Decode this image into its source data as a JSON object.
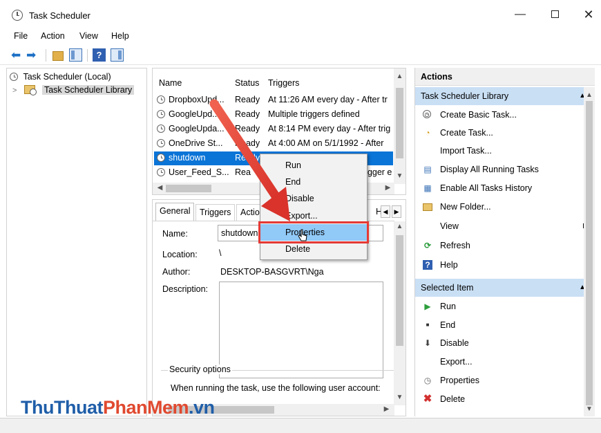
{
  "window": {
    "title": "Task Scheduler",
    "min": "—",
    "close": "✕"
  },
  "menu": [
    "File",
    "Action",
    "View",
    "Help"
  ],
  "toolbar": {
    "help_label": "?"
  },
  "tree": {
    "root": "Task Scheduler (Local)",
    "library": "Task Scheduler Library"
  },
  "tasklist": {
    "columns": [
      "Name",
      "Status",
      "Triggers"
    ],
    "rows": [
      {
        "name": "DropboxUpd...",
        "status": "Ready",
        "triggers": "At 11:26 AM every day - After tr"
      },
      {
        "name": "GoogleUpd...",
        "status": "Ready",
        "triggers": "Multiple triggers defined"
      },
      {
        "name": "GoogleUpda...",
        "status": "Ready",
        "triggers": "At 8:14 PM every day - After trig"
      },
      {
        "name": "OneDrive St...",
        "status": "Ready",
        "triggers": "At 4:00 AM on 5/1/1992 - After"
      },
      {
        "name": "shutdown",
        "status": "Ready",
        "triggers": ""
      },
      {
        "name": "User_Feed_S...",
        "status": "Rea",
        "triggers": "rigger e"
      }
    ],
    "selected_index": 4
  },
  "detail": {
    "tabs": [
      "General",
      "Triggers",
      "Actio",
      "H"
    ],
    "name_label": "Name:",
    "name_value": "shutdown",
    "location_label": "Location:",
    "location_value": "\\",
    "author_label": "Author:",
    "author_value": "DESKTOP-BASGVRT\\Nga",
    "description_label": "Description:",
    "security_label": "Security options",
    "security_text": "When running the task, use the following user account:"
  },
  "actions": {
    "header": "Actions",
    "library_section": "Task Scheduler Library",
    "library_items": [
      {
        "label": "Create Basic Task...",
        "icon": "create-basic-task-icon"
      },
      {
        "label": "Create Task...",
        "icon": "create-task-icon"
      },
      {
        "label": "Import Task...",
        "icon": ""
      },
      {
        "label": "Display All Running Tasks",
        "icon": "running-tasks-icon"
      },
      {
        "label": "Enable All Tasks History",
        "icon": "history-icon"
      },
      {
        "label": "New Folder...",
        "icon": "folder-icon"
      },
      {
        "label": "View",
        "icon": ""
      },
      {
        "label": "Refresh",
        "icon": "refresh-icon"
      },
      {
        "label": "Help",
        "icon": "help-icon"
      }
    ],
    "selected_section": "Selected Item",
    "selected_items": [
      {
        "label": "Run",
        "icon": "run-icon"
      },
      {
        "label": "End",
        "icon": "end-icon"
      },
      {
        "label": "Disable",
        "icon": "disable-icon"
      },
      {
        "label": "Export...",
        "icon": ""
      },
      {
        "label": "Properties",
        "icon": "properties-icon"
      },
      {
        "label": "Delete",
        "icon": "delete-icon"
      }
    ]
  },
  "context_menu": {
    "items": [
      "Run",
      "End",
      "Disable",
      "Export...",
      "Properties",
      "Delete"
    ],
    "hover_index": 4
  },
  "watermark": {
    "part1": "ThuThuat",
    "part2": "PhanMem",
    "part3": ".vn"
  },
  "colors": {
    "selection": "#0a74d7",
    "section_bg": "#c9dff4",
    "highlight_box": "#e53935",
    "arrow": "#e8453c"
  }
}
